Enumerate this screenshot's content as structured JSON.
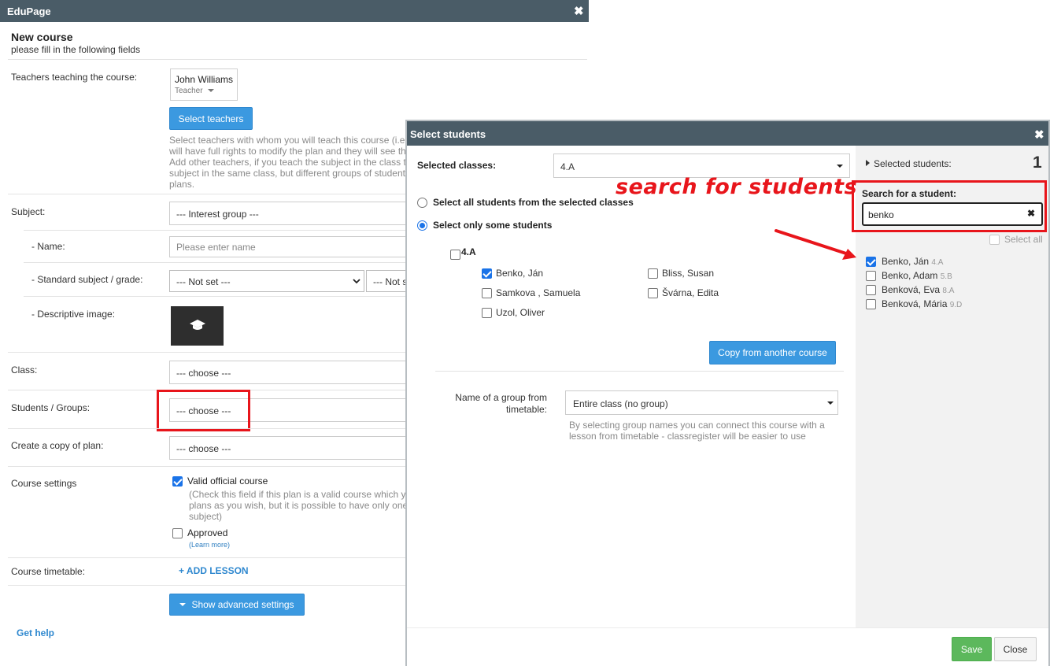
{
  "window": {
    "title": "EduPage"
  },
  "header": {
    "title": "New course",
    "subtitle": "please fill in the following fields"
  },
  "teachers": {
    "label": "Teachers teaching the course:",
    "teacher_name": "John Williams",
    "teacher_role": "Teacher",
    "select_button": "Select teachers",
    "help_lines": [
      "Select teachers with whom you will teach this course (i.e.",
      "will have full rights to modify the plan and they will see th",
      "Add other teachers, if you teach the subject in the class t",
      "subject in the same class, but different groups of student",
      "plans."
    ]
  },
  "subject": {
    "label": "Subject:",
    "value": "--- Interest group ---",
    "name_label": "- Name:",
    "name_placeholder": "Please enter name",
    "standard_label": "- Standard subject / grade:",
    "standard_value": "--- Not set ---",
    "standard_value2": "--- Not s",
    "image_label": "- Descriptive image:"
  },
  "class_field": {
    "label": "Class:",
    "value": "--- choose ---"
  },
  "students_groups": {
    "label": "Students / Groups:",
    "value": "--- choose ---"
  },
  "copy_plan": {
    "label": "Create a copy of plan:",
    "value": "--- choose ---"
  },
  "course_settings": {
    "label": "Course settings",
    "valid_label": "Valid official course",
    "valid_checked": true,
    "valid_help": [
      "(Check this field if this plan is a valid course which y",
      "plans as you wish, but it is possible to have only one",
      "subject)"
    ],
    "approved_label": "Approved",
    "approved_checked": false,
    "learn_more": "(Learn more)"
  },
  "timetable": {
    "label": "Course timetable:",
    "add_lesson": "+ ADD LESSON"
  },
  "advanced_button": "Show advanced settings",
  "get_help": "Get help",
  "dialog": {
    "title": "Select students",
    "selected_classes_label": "Selected classes:",
    "selected_classes_value": "4.A",
    "radio_all": "Select all students from the selected classes",
    "radio_some": "Select only some students",
    "radio_selected": "some",
    "class_group_label": "4.A",
    "students": [
      {
        "name": "Benko, Ján",
        "checked": true
      },
      {
        "name": "Bliss, Susan",
        "checked": false
      },
      {
        "name": "Samkova , Samuela",
        "checked": false
      },
      {
        "name": "Švárna, Edita",
        "checked": false
      },
      {
        "name": "Uzol, Oliver",
        "checked": false
      }
    ],
    "copy_button": "Copy from another course",
    "group_name_label_line1": "Name of a group from",
    "group_name_label_line2": "timetable:",
    "group_name_value": "Entire class (no group)",
    "group_help_line1": "By selecting group names you can connect this course with a",
    "group_help_line2": "lesson from timetable - classregister will be easier to use",
    "selected_students_label": "Selected students:",
    "selected_students_count": "1",
    "search_label": "Search for a student:",
    "search_value": "benko",
    "select_all_label": "Select all",
    "results": [
      {
        "name": "Benko, Ján",
        "class": "4.A",
        "checked": true
      },
      {
        "name": "Benko, Adam",
        "class": "5.B",
        "checked": false
      },
      {
        "name": "Benková, Eva",
        "class": "8.A",
        "checked": false
      },
      {
        "name": "Benková, Mária",
        "class": "9.D",
        "checked": false
      }
    ],
    "save_button": "Save",
    "close_button": "Close"
  },
  "annotation": {
    "text": "search for students",
    "color": "#e8151b"
  },
  "colors": {
    "titlebar": "#4a5c67",
    "primary": "#3b99e0",
    "success": "#5cb85c",
    "highlight": "#e8151b"
  }
}
